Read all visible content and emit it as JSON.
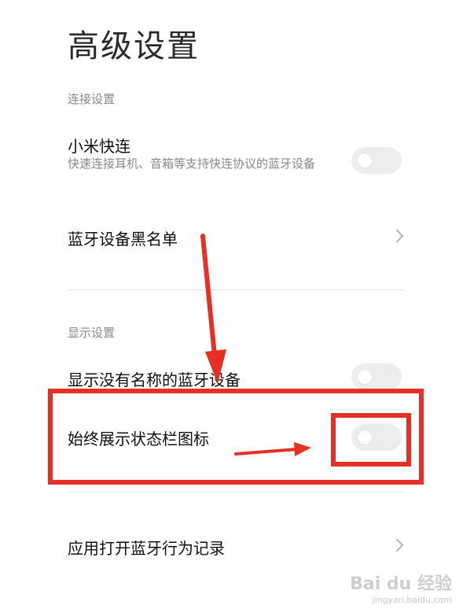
{
  "page": {
    "title": "高级设置"
  },
  "sections": {
    "connection": {
      "header": "连接设置",
      "xiaomi_quick_connect": {
        "title": "小米快连",
        "subtitle": "快速连接耳机、音箱等支持快连协议的蓝牙设备",
        "toggle_on": false
      },
      "bluetooth_blacklist": {
        "title": "蓝牙设备黑名单",
        "icon": "chevron-right-icon"
      }
    },
    "display": {
      "header": "显示设置",
      "show_unnamed_devices": {
        "title": "显示没有名称的蓝牙设备",
        "toggle_on": false
      },
      "always_show_status_bar_icon": {
        "title": "始终展示状态栏图标",
        "toggle_on": false
      }
    },
    "records": {
      "app_bluetooth_records": {
        "title": "应用打开蓝牙行为记录",
        "icon": "chevron-right-icon"
      }
    }
  },
  "annotation": {
    "color": "#e53125"
  },
  "watermark": {
    "brand": "Bai du 经验",
    "url": "jingyan.baidu.com"
  }
}
